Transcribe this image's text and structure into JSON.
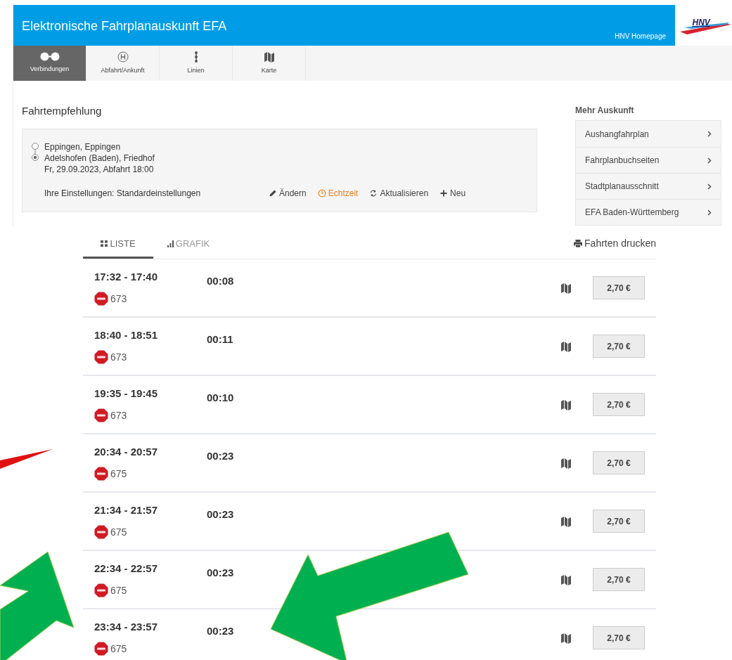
{
  "header": {
    "title": "Elektronische Fahrplanauskunft EFA",
    "homepage_link": "HNV Homepage",
    "logo": "HNV"
  },
  "nav_tabs": [
    {
      "kind": "ab",
      "label": "Verbindungen",
      "selected": true
    },
    {
      "kind": "stop",
      "label": "Abfahrt/Ankunft",
      "selected": false
    },
    {
      "kind": "line",
      "label": "Linien",
      "selected": false
    },
    {
      "kind": "map",
      "label": "Karte",
      "selected": false
    }
  ],
  "section_title": "Fahrtempfehlung",
  "request": {
    "origin": "Eppingen, Eppingen",
    "destination": "Adelshofen (Baden), Friedhof",
    "date_time": "Fr, 29.09.2023, Abfahrt 18:00",
    "settings": "Ihre Einstellungen: Standardeinstellungen",
    "actions": [
      {
        "kind": "edit",
        "label": "Ändern"
      },
      {
        "kind": "realtime",
        "label": "Echtzeit"
      },
      {
        "kind": "refresh",
        "label": "Aktualisieren"
      },
      {
        "kind": "new",
        "label": "Neu"
      }
    ]
  },
  "sidebar": {
    "title": "Mehr Auskunft",
    "items": [
      "Aushangfahrplan",
      "Fahrplanbuchseiten",
      "Stadtplanausschnitt",
      "EFA Baden-Württemberg"
    ]
  },
  "view_tabs": [
    {
      "kind": "list",
      "label": "LISTE",
      "selected": true
    },
    {
      "kind": "chart",
      "label": "GRAFIK",
      "selected": false
    }
  ],
  "print_link": "Fahrten drucken",
  "trips": [
    {
      "time": "17:32 - 17:40",
      "duration": "00:08",
      "line": "673",
      "price": "2,70 €"
    },
    {
      "time": "18:40 - 18:51",
      "duration": "00:11",
      "line": "673",
      "price": "2,70 €"
    },
    {
      "time": "19:35 - 19:45",
      "duration": "00:10",
      "line": "673",
      "price": "2,70 €"
    },
    {
      "time": "20:34 - 20:57",
      "duration": "00:23",
      "line": "675",
      "price": "2,70 €"
    },
    {
      "time": "21:34 - 21:57",
      "duration": "00:23",
      "line": "675",
      "price": "2,70 €"
    },
    {
      "time": "22:34 - 22:57",
      "duration": "00:23",
      "line": "675",
      "price": "2,70 €"
    },
    {
      "time": "23:34 - 23:57",
      "duration": "00:23",
      "line": "675",
      "price": "2,70 €"
    }
  ]
}
